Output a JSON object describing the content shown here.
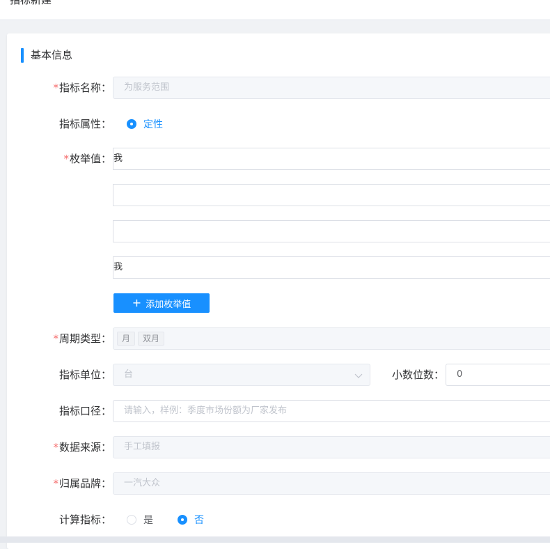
{
  "page": {
    "title": "指标新建",
    "section_title": "基本信息",
    "colors": {
      "accent": "#1890ff",
      "required": "#f56c6c",
      "text": "#303133",
      "disabled_bg": "#f5f7fa"
    }
  },
  "form": {
    "name": {
      "label": "指标名称：",
      "required": "*",
      "placeholder": "为服务范围"
    },
    "attribute": {
      "label": "指标属性：",
      "option": "定性",
      "selected": true
    },
    "enum": {
      "label": "枚举值：",
      "required": "*",
      "values": [
        "我",
        "",
        "",
        "我"
      ],
      "add_button": "添加枚举值",
      "add_icon": "plus-icon"
    },
    "period": {
      "label": "周期类型：",
      "required": "*",
      "tags": [
        "月",
        "双月"
      ]
    },
    "unit": {
      "label": "指标单位：",
      "placeholder": "台",
      "icon": "chevron-down-icon"
    },
    "decimal": {
      "label": "小数位数：",
      "value": "0"
    },
    "caliber": {
      "label": "指标口径：",
      "placeholder": "请输入，样例：季度市场份额为厂家发布"
    },
    "source": {
      "label": "数据来源：",
      "required": "*",
      "placeholder": "手工填报"
    },
    "brand": {
      "label": "归属品牌：",
      "required": "*",
      "placeholder": "一汽大众"
    },
    "calc": {
      "label": "计算指标：",
      "yes": "是",
      "no": "否",
      "selected": "否"
    }
  }
}
